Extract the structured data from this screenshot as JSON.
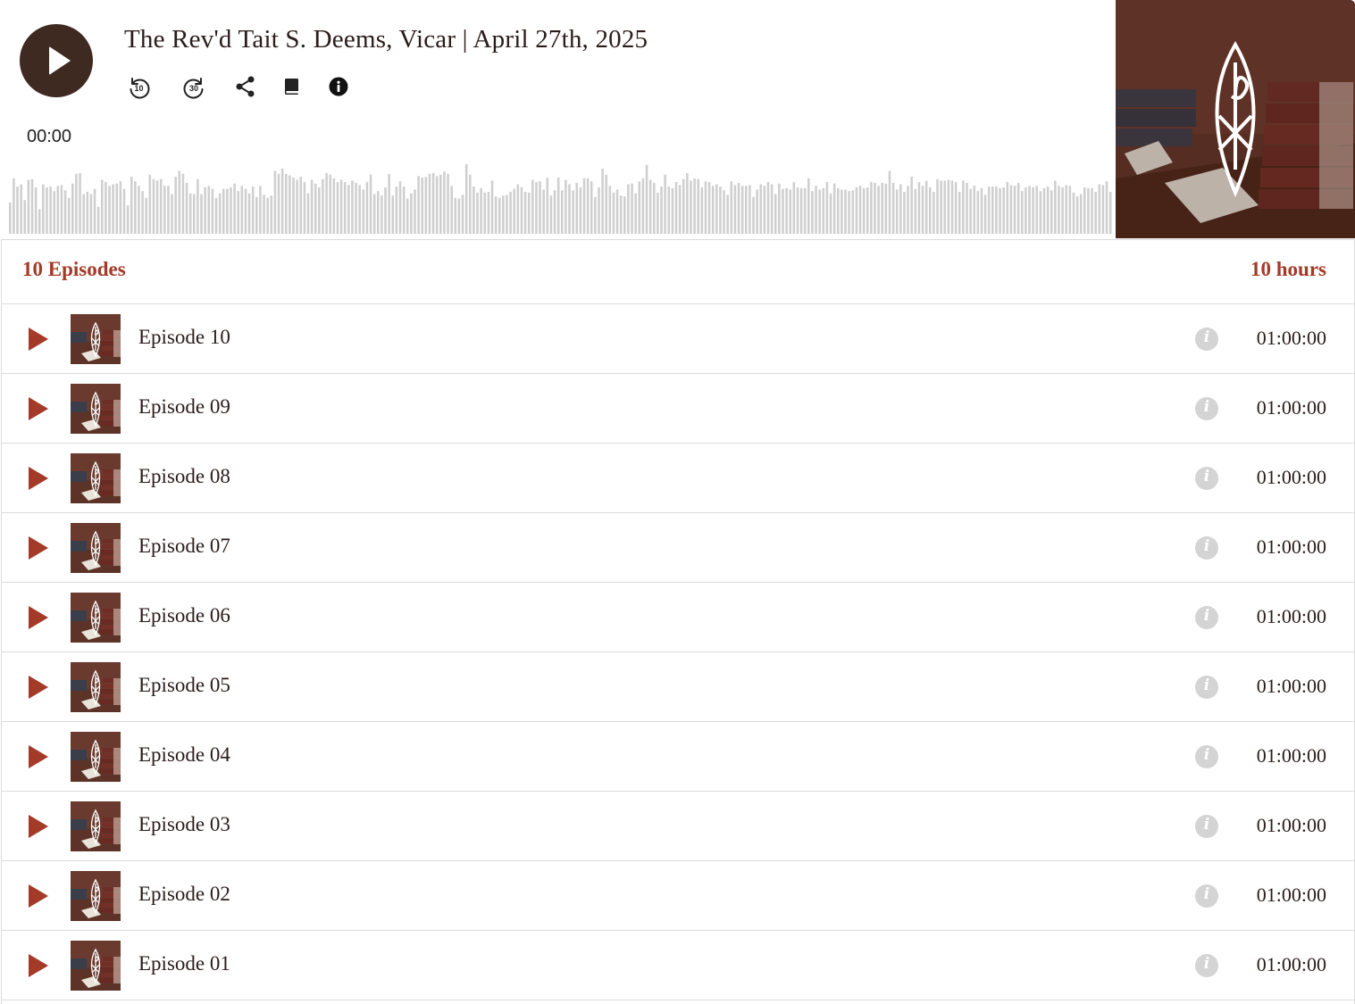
{
  "player": {
    "title": "The Rev'd Tait S. Deems, Vicar | April 27th, 2025",
    "current_time": "00:00",
    "buttons": {
      "rewind_label": "10",
      "forward_label": "30"
    },
    "icons": [
      "play-icon",
      "rewind-10-icon",
      "forward-30-icon",
      "share-icon",
      "book-icon",
      "info-icon"
    ],
    "waveform_levels": [
      0.42,
      0.74,
      0.63,
      0.66,
      0.45,
      0.72,
      0.73,
      0.62,
      0.33,
      0.66,
      0.62,
      0.63,
      0.57,
      0.64,
      0.65,
      0.58,
      0.48,
      0.67,
      0.8,
      0.81,
      0.53,
      0.56,
      0.53,
      0.6,
      0.36,
      0.72,
      0.69,
      0.64,
      0.66,
      0.67,
      0.7,
      0.6,
      0.38,
      0.76,
      0.7,
      0.64,
      0.57,
      0.48,
      0.79,
      0.73,
      0.71,
      0.73,
      0.64,
      0.64,
      0.53,
      0.76,
      0.84,
      0.8,
      0.68,
      0.54,
      0.53,
      0.73,
      0.53,
      0.62,
      0.64,
      0.6,
      0.48,
      0.54,
      0.6,
      0.6,
      0.62,
      0.67,
      0.57,
      0.64,
      0.6,
      0.54,
      0.63,
      0.49,
      0.64,
      0.52,
      0.48,
      0.51,
      0.84,
      0.8,
      0.87,
      0.8,
      0.78,
      0.75,
      0.72,
      0.76,
      0.69,
      0.54,
      0.72,
      0.67,
      0.62,
      0.73,
      0.81,
      0.79,
      0.74,
      0.69,
      0.72,
      0.69,
      0.65,
      0.71,
      0.68,
      0.65,
      0.59,
      0.69,
      0.79,
      0.53,
      0.57,
      0.51,
      0.62,
      0.8,
      0.51,
      0.63,
      0.7,
      0.63,
      0.47,
      0.54,
      0.59,
      0.77,
      0.75,
      0.76,
      0.8,
      0.81,
      0.77,
      0.79,
      0.83,
      0.8,
      0.64,
      0.48,
      0.47,
      0.52,
      0.93,
      0.79,
      0.63,
      0.55,
      0.61,
      0.55,
      0.56,
      0.71,
      0.5,
      0.48,
      0.51,
      0.52,
      0.56,
      0.6,
      0.66,
      0.62,
      0.56,
      0.55,
      0.72,
      0.69,
      0.7,
      0.59,
      0.75,
      0.51,
      0.58,
      0.75,
      0.58,
      0.72,
      0.66,
      0.58,
      0.68,
      0.62,
      0.74,
      0.74,
      0.7,
      0.49,
      0.62,
      0.87,
      0.79,
      0.64,
      0.55,
      0.59,
      0.51,
      0.5,
      0.66,
      0.67,
      0.54,
      0.7,
      0.74,
      0.92,
      0.72,
      0.68,
      0.55,
      0.63,
      0.79,
      0.63,
      0.61,
      0.69,
      0.65,
      0.73,
      0.81,
      0.71,
      0.74,
      0.73,
      0.62,
      0.7,
      0.69,
      0.64,
      0.66,
      0.63,
      0.58,
      0.52,
      0.7,
      0.65,
      0.68,
      0.64,
      0.64,
      0.65,
      0.49,
      0.59,
      0.66,
      0.64,
      0.69,
      0.66,
      0.53,
      0.67,
      0.6,
      0.61,
      0.59,
      0.69,
      0.62,
      0.61,
      0.61,
      0.74,
      0.57,
      0.64,
      0.59,
      0.61,
      0.69,
      0.54,
      0.67,
      0.61,
      0.59,
      0.59,
      0.57,
      0.58,
      0.62,
      0.64,
      0.61,
      0.62,
      0.69,
      0.68,
      0.64,
      0.68,
      0.67,
      0.84,
      0.68,
      0.59,
      0.66,
      0.56,
      0.64,
      0.76,
      0.6,
      0.69,
      0.64,
      0.71,
      0.62,
      0.56,
      0.73,
      0.71,
      0.71,
      0.72,
      0.71,
      0.69,
      0.56,
      0.71,
      0.68,
      0.6,
      0.64,
      0.57,
      0.61,
      0.52,
      0.63,
      0.63,
      0.63,
      0.61,
      0.62,
      0.69,
      0.65,
      0.64,
      0.68,
      0.57,
      0.62,
      0.64,
      0.62,
      0.64,
      0.57,
      0.61,
      0.63,
      0.58,
      0.71,
      0.64,
      0.62,
      0.65,
      0.64,
      0.55,
      0.5,
      0.53,
      0.62,
      0.61,
      0.61,
      0.56,
      0.66,
      0.65,
      0.7,
      0.56
    ]
  },
  "list_header": {
    "episode_count": "10 Episodes",
    "total_duration": "10 hours"
  },
  "episodes": [
    {
      "title": "Episode 10",
      "duration": "01:00:00",
      "info_label": "i"
    },
    {
      "title": "Episode 09",
      "duration": "01:00:00",
      "info_label": "i"
    },
    {
      "title": "Episode 08",
      "duration": "01:00:00",
      "info_label": "i"
    },
    {
      "title": "Episode 07",
      "duration": "01:00:00",
      "info_label": "i"
    },
    {
      "title": "Episode 06",
      "duration": "01:00:00",
      "info_label": "i"
    },
    {
      "title": "Episode 05",
      "duration": "01:00:00",
      "info_label": "i"
    },
    {
      "title": "Episode 04",
      "duration": "01:00:00",
      "info_label": "i"
    },
    {
      "title": "Episode 03",
      "duration": "01:00:00",
      "info_label": "i"
    },
    {
      "title": "Episode 02",
      "duration": "01:00:00",
      "info_label": "i"
    },
    {
      "title": "Episode 01",
      "duration": "01:00:00",
      "info_label": "i"
    }
  ],
  "colors": {
    "accent": "#a43a28",
    "play_button": "#3f2a21",
    "waveform_bar": "#cfcfcf",
    "info_icon": "#d4d4d4",
    "divider": "#dcdcdc"
  }
}
